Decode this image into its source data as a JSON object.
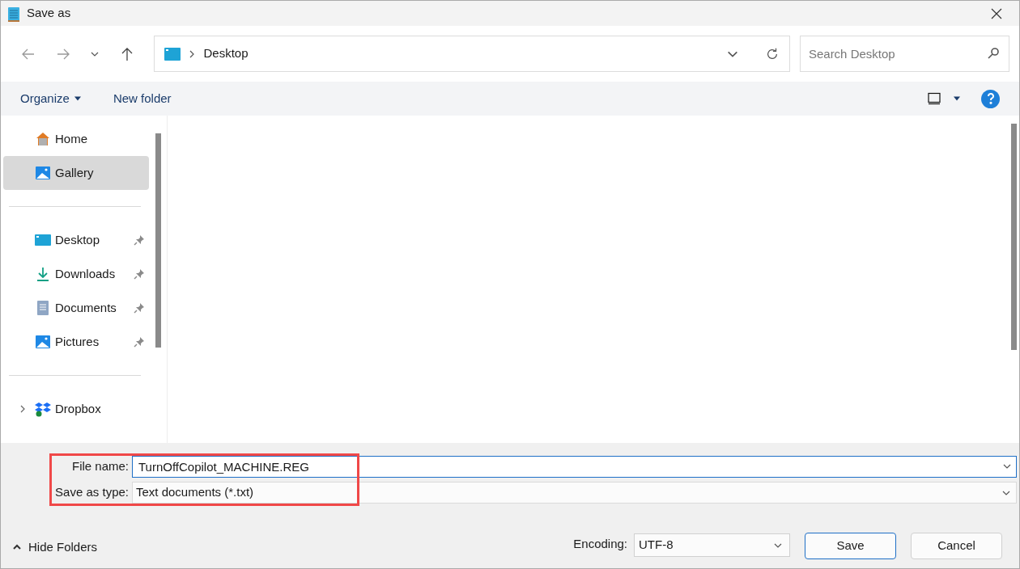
{
  "window": {
    "title": "Save as"
  },
  "address": {
    "location": "Desktop",
    "search_placeholder": "Search Desktop"
  },
  "toolbar": {
    "organize": "Organize",
    "new_folder": "New folder"
  },
  "sidebar": {
    "groups": [
      [
        {
          "label": "Home",
          "kind": "home",
          "selected": false,
          "pinned": false,
          "expandable": false
        },
        {
          "label": "Gallery",
          "kind": "gallery",
          "selected": true,
          "pinned": false,
          "expandable": false
        }
      ],
      [
        {
          "label": "Desktop",
          "kind": "desktop",
          "selected": false,
          "pinned": true,
          "expandable": false
        },
        {
          "label": "Downloads",
          "kind": "downloads",
          "selected": false,
          "pinned": true,
          "expandable": false
        },
        {
          "label": "Documents",
          "kind": "documents",
          "selected": false,
          "pinned": true,
          "expandable": false
        },
        {
          "label": "Pictures",
          "kind": "pictures",
          "selected": false,
          "pinned": true,
          "expandable": false
        }
      ],
      [
        {
          "label": "Dropbox",
          "kind": "dropbox",
          "selected": false,
          "pinned": false,
          "expandable": true
        }
      ]
    ]
  },
  "form": {
    "file_name_label": "File name:",
    "file_name": "TurnOffCopilot_MACHINE.REG",
    "type_label": "Save as type:",
    "type": "Text documents (*.txt)",
    "highlighted": true
  },
  "footer": {
    "hide_folders": "Hide Folders",
    "encoding_label": "Encoding:",
    "encoding": "UTF-8",
    "buttons": [
      {
        "label": "Save",
        "default": true
      },
      {
        "label": "Cancel",
        "default": false
      }
    ]
  }
}
